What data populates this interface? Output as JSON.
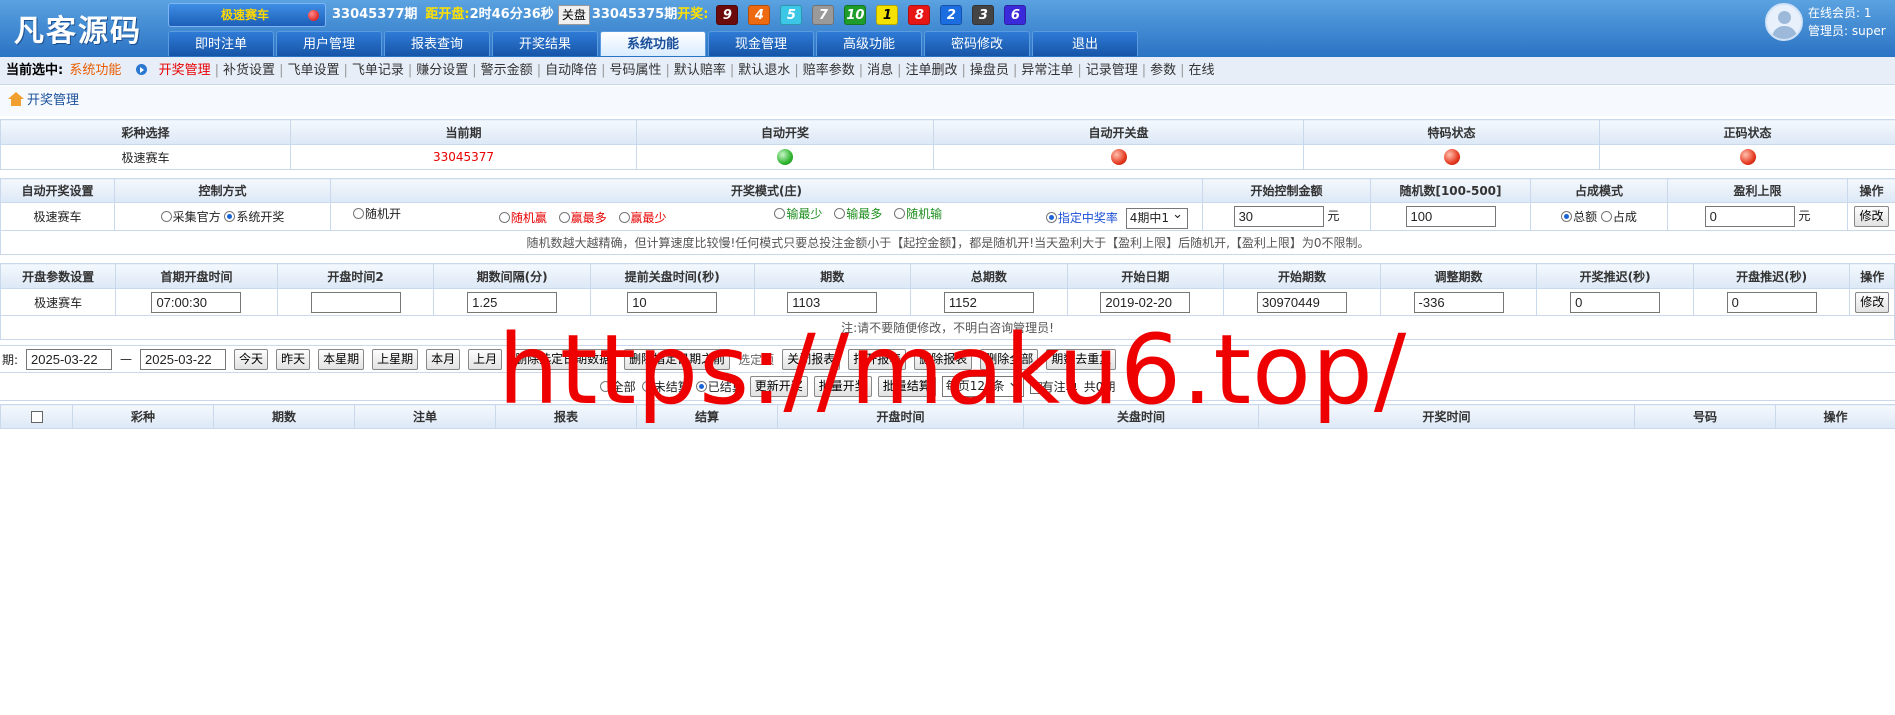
{
  "header": {
    "logo": "凡客源码",
    "game": "极速赛车",
    "period": "33045377期",
    "countdown_label": "距开盘:",
    "countdown": "2时46分36秒",
    "closed": "关盘",
    "prev_period": "33045375期",
    "prev_label": "开奖:",
    "balls": [
      {
        "num": "9",
        "color": "#6b0b0b"
      },
      {
        "num": "4",
        "color": "#ee6a10"
      },
      {
        "num": "5",
        "color": "#3cc7e6"
      },
      {
        "num": "7",
        "color": "#9a9a9a"
      },
      {
        "num": "10",
        "color": "#1f9d2a"
      },
      {
        "num": "1",
        "color": "#f5e100"
      },
      {
        "num": "8",
        "color": "#e81515"
      },
      {
        "num": "2",
        "color": "#1c6de0"
      },
      {
        "num": "3",
        "color": "#444444"
      },
      {
        "num": "6",
        "color": "#3b2ad9"
      }
    ],
    "online_label": "在线会员:",
    "online_count": "1",
    "admin_label": "管理员:",
    "admin_name": "super"
  },
  "nav": [
    "即时注单",
    "用户管理",
    "报表查询",
    "开奖结果",
    "系统功能",
    "现金管理",
    "高级功能",
    "密码修改",
    "退出"
  ],
  "subnav": {
    "current_label": "当前选中:",
    "current_value": "系统功能",
    "items": [
      "开奖管理",
      "补货设置",
      "飞单设置",
      "飞单记录",
      "赚分设置",
      "警示金额",
      "自动降倍",
      "号码属性",
      "默认赔率",
      "默认退水",
      "赔率参数",
      "消息",
      "注单删改",
      "操盘员",
      "异常注单",
      "记录管理",
      "参数",
      "在线"
    ]
  },
  "breadcrumb": "开奖管理",
  "status_table": {
    "headers": [
      "彩种选择",
      "当前期",
      "自动开奖",
      "自动开关盘",
      "特码状态",
      "正码状态"
    ],
    "game": "极速赛车",
    "period": "33045377"
  },
  "auto_table": {
    "headers": [
      "自动开奖设置",
      "控制方式",
      "开奖模式(庄)",
      "开始控制金额",
      "随机数[100-500]",
      "占成模式",
      "盈利上限",
      "操作"
    ],
    "game": "极速赛车",
    "control": [
      "采集官方",
      "系统开奖"
    ],
    "modes": [
      "随机开",
      "随机赢",
      "赢最多",
      "赢最少",
      "输最少",
      "输最多",
      "随机输",
      "指定中奖率"
    ],
    "rate_select": "4期中1",
    "start_amount": "30",
    "yuan": "元",
    "random_num": "100",
    "share": [
      "总额",
      "占成"
    ],
    "profit_limit": "0",
    "modify": "修改",
    "note": "随机数越大越精确，但计算速度比较慢!任何模式只要总投注金额小于【起控金额】，都是随机开!当天盈利大于【盈利上限】后随机开,【盈利上限】为0不限制。"
  },
  "open_table": {
    "headers": [
      "开盘参数设置",
      "首期开盘时间",
      "开盘时间2",
      "期数间隔(分)",
      "提前关盘时间(秒)",
      "期数",
      "总期数",
      "开始日期",
      "开始期数",
      "调整期数",
      "开奖推迟(秒)",
      "开盘推迟(秒)",
      "操作"
    ],
    "game": "极速赛车",
    "first_time": "07:00:30",
    "time2": "",
    "interval": "1.25",
    "close_ahead": "10",
    "periods": "1103",
    "total": "1152",
    "start_date": "2019-02-20",
    "start_period": "30970449",
    "adjust": "-336",
    "draw_delay": "0",
    "open_delay": "0",
    "modify": "修改",
    "note": "注:请不要随便修改，不明白咨询管理员!"
  },
  "query": {
    "date_label": "日期:",
    "date_from": "2025-03-22",
    "dash": "—",
    "date_to": "2025-03-22",
    "buttons": [
      "今天",
      "昨天",
      "本星期",
      "上星期",
      "本月",
      "上月",
      "删除选定日期数据",
      "删除指定日期之前",
      "选定项",
      "关闭报表",
      "打开报表",
      "删除报表",
      "删除全部",
      "期数去重复"
    ],
    "filters": [
      "全部",
      "未结算",
      "已结算"
    ],
    "actions": [
      "更新开奖",
      "批量开奖",
      "批量结算"
    ],
    "per_select": "每页120条",
    "has_bet": "有注单",
    "count_text": "共0期"
  },
  "list_table": {
    "headers": [
      "彩种",
      "期数",
      "注单",
      "报表",
      "结算",
      "开盘时间",
      "关盘时间",
      "开奖时间",
      "号码",
      "操作"
    ]
  },
  "watermark": "https://maku6.top/"
}
